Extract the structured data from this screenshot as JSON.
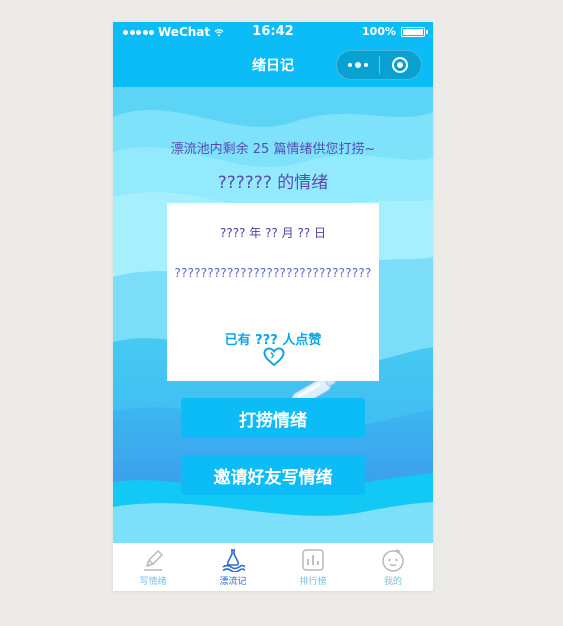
{
  "status_bar": {
    "carrier": "WeChat",
    "time": "16:42",
    "battery": "100%"
  },
  "nav": {
    "title": "绪日记"
  },
  "main": {
    "pool_text": "漂流池内剩余 25 篇情绪供您打捞~",
    "owner_text": "?????? 的情绪",
    "card": {
      "date": "???? 年 ?? 月 ?? 日",
      "content": "??????????????????????????????",
      "likes": "已有 ??? 人点赞"
    },
    "buttons": {
      "fish": "打捞情绪",
      "invite": "邀请好友写情绪"
    }
  },
  "tab_bar": {
    "items": [
      {
        "label": "写情绪",
        "icon": "pencil-icon"
      },
      {
        "label": "漂流记",
        "icon": "bottle-icon",
        "active": true
      },
      {
        "label": "排行榜",
        "icon": "bar-chart-icon"
      },
      {
        "label": "我的",
        "icon": "face-icon"
      }
    ]
  },
  "colors": {
    "primary": "#0bbcf7",
    "text_purple": "#5a4bb2",
    "likes_blue": "#10a6e6",
    "background": "#ecebe7"
  }
}
